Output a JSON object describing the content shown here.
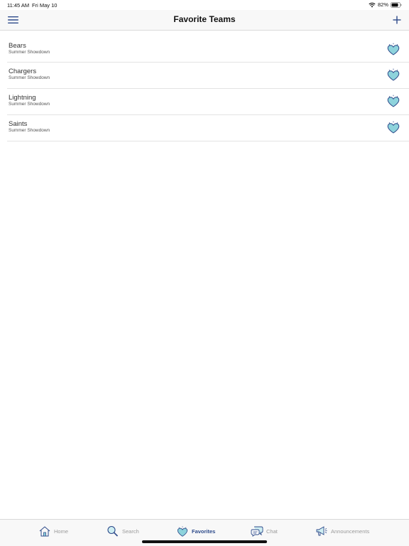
{
  "status_bar": {
    "time": "11:45 AM",
    "date": "Fri May 10",
    "battery": "82%",
    "wifi_icon": "wifi-icon",
    "battery_icon": "battery-icon"
  },
  "nav": {
    "title": "Favorite Teams",
    "menu_icon": "hamburger-menu-icon",
    "add_icon": "plus-icon"
  },
  "teams": [
    {
      "name": "Bears",
      "event": "Summer Showdown"
    },
    {
      "name": "Chargers",
      "event": "Summer Showdown"
    },
    {
      "name": "Lightning",
      "event": "Summer Showdown"
    },
    {
      "name": "Saints",
      "event": "Summer Showdown"
    }
  ],
  "tabs": [
    {
      "label": "Home",
      "icon": "home-icon",
      "active": false
    },
    {
      "label": "Search",
      "icon": "search-icon",
      "active": false
    },
    {
      "label": "Favorites",
      "icon": "heart-icon",
      "active": true
    },
    {
      "label": "Chat",
      "icon": "chat-icon",
      "active": false
    },
    {
      "label": "Announcements",
      "icon": "megaphone-icon",
      "active": false
    }
  ],
  "colors": {
    "accent": "#2d4a8a",
    "heart_fill": "#8ed3dc",
    "inactive": "#9a9a9a"
  }
}
